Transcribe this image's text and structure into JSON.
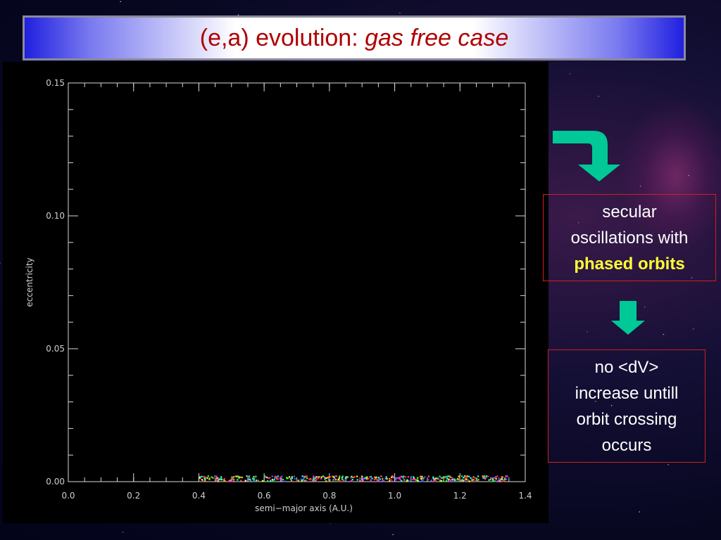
{
  "title": {
    "prefix": "(e,a) evolution: ",
    "italic": "gas free case",
    "text_color": "#b00000"
  },
  "annotations": {
    "box1": {
      "line1": "secular",
      "line2": "oscillations with",
      "highlight": "phased orbits",
      "highlight_color": "#ffff33"
    },
    "box2": {
      "line1": "no <dV>",
      "line2": "increase untill",
      "line3": "orbit crossing",
      "line4": "occurs"
    },
    "arrow_color": "#00c896"
  },
  "chart_data": {
    "type": "scatter",
    "xlabel": "semi−major axis (A.U.)",
    "ylabel": "eccentricity",
    "xlim": [
      0.0,
      1.4
    ],
    "ylim": [
      0.0,
      0.15
    ],
    "x_ticks": [
      "0.0",
      "0.2",
      "0.4",
      "0.6",
      "0.8",
      "1.0",
      "1.2",
      "1.4"
    ],
    "y_ticks": [
      "0.00",
      "0.05",
      "0.10",
      "0.15"
    ],
    "points_range": {
      "x_min": 0.4,
      "x_max": 1.35,
      "y_max": 0.002
    },
    "marker_colors": [
      "#ff3030",
      "#30ff30",
      "#3070ff",
      "#ffff30",
      "#ff30ff",
      "#30ffff",
      "#ff9a20"
    ],
    "grid": false
  }
}
